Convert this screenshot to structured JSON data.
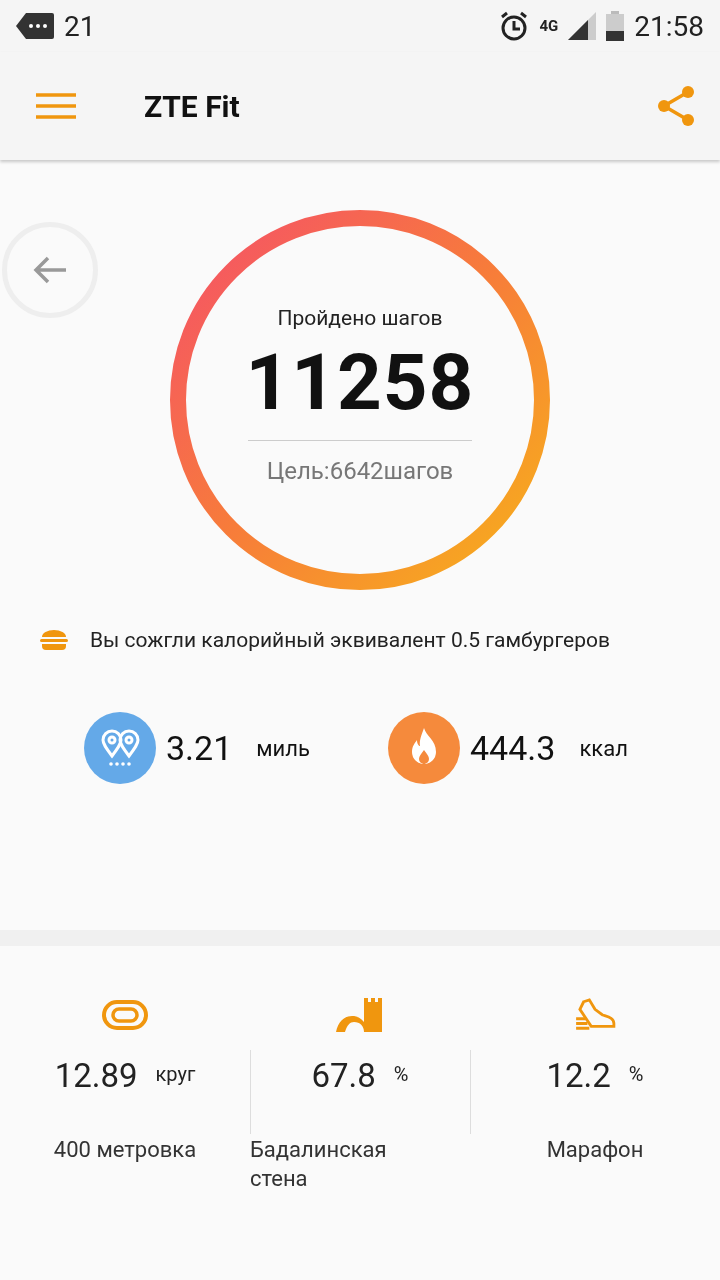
{
  "status_bar": {
    "notification_count": "21",
    "network": "4G",
    "time": "21:58"
  },
  "app_bar": {
    "title": "ZTE Fit"
  },
  "steps": {
    "label": "Пройдено шагов",
    "value": "11258",
    "goal": "Цель:6642шагов"
  },
  "burger_note": "Вы сожгли калорийный эквивалент 0.5 гамбургеров",
  "stats": [
    {
      "kind": "distance",
      "value": "3.21",
      "unit": "миль"
    },
    {
      "kind": "calories",
      "value": "444.3",
      "unit": "ккал"
    }
  ],
  "achievements": [
    {
      "kind": "track",
      "value": "12.89",
      "unit": "круг",
      "label": "400 метровка"
    },
    {
      "kind": "wall",
      "value": "67.8",
      "unit": "%",
      "label": "Бадалинская стена"
    },
    {
      "kind": "shoe",
      "value": "12.2",
      "unit": "%",
      "label": "Марафон"
    }
  ]
}
